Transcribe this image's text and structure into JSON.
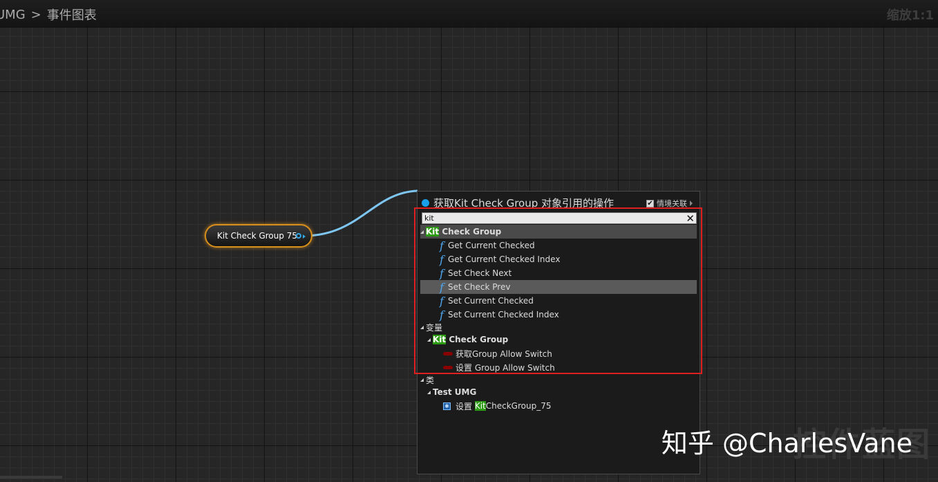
{
  "breadcrumb": {
    "parent": "UMG",
    "separator": ">",
    "current": "事件图表"
  },
  "zoom_label": "缩放1:1",
  "node": {
    "label": "Kit Check Group 75",
    "border_color": "#d9901a",
    "pin_color": "#33a8e8"
  },
  "menu": {
    "title": "获取Kit Check Group 对象引用的操作",
    "context_sensitive": {
      "label": "情境关联",
      "checked": true,
      "check_mark": "✔"
    },
    "search": {
      "value": "kit",
      "clear_glyph": "✕"
    },
    "function_category": {
      "highlight": "Kit",
      "rest": " Check Group"
    },
    "functions": [
      {
        "label": "Get Current Checked",
        "icon": "function-icon"
      },
      {
        "label": "Get Current Checked Index",
        "icon": "function-icon"
      },
      {
        "label": "Set Check Next",
        "icon": "function-icon"
      },
      {
        "label": "Set Check Prev",
        "icon": "function-icon",
        "selected": true
      },
      {
        "label": "Set Current Checked",
        "icon": "function-icon"
      },
      {
        "label": "Set Current Checked Index",
        "icon": "function-icon"
      }
    ],
    "function_glyph": "f",
    "variables_category": "变量",
    "variables_sub": {
      "highlight": "Kit",
      "rest": " Check Group"
    },
    "variables": [
      {
        "label": "获取Group Allow Switch",
        "icon": "bool-pill-icon"
      },
      {
        "label": "设置 Group Allow Switch",
        "icon": "bool-pill-icon"
      }
    ],
    "class_category": "类",
    "class_sub": "Test UMG",
    "class_item": {
      "prefix": "设置 ",
      "highlight": "Kit",
      "rest": "CheckGroup_75",
      "icon_glyph": "✱"
    }
  },
  "watermark": {
    "text": "知乎 @CharlesVane",
    "background_text": "控件蓝图"
  },
  "colors": {
    "accent_blue": "#19a0ea",
    "highlight_green": "#2d9a14",
    "annotation_red": "#e02020"
  }
}
